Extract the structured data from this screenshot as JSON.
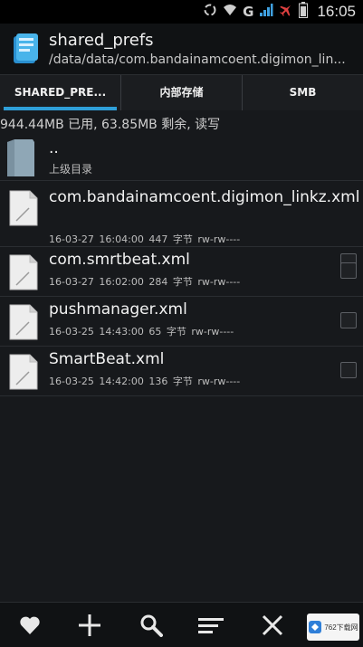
{
  "status_bar": {
    "time": "16:05",
    "network": "G",
    "icons": [
      "sync-icon",
      "wifi-icon",
      "signal-icon",
      "airplane-icon",
      "battery-icon"
    ]
  },
  "header": {
    "title": "shared_prefs",
    "path": "/data/data/com.bandainamcoent.digimon_lin..."
  },
  "tabs": [
    {
      "label": "SHARED_PRE...",
      "active": true
    },
    {
      "label": "内部存储",
      "active": false
    },
    {
      "label": "SMB",
      "active": false
    }
  ],
  "storage_info": "944.44MB 已用, 63.85MB 剩余, 读写",
  "parent_dir": {
    "name": "..",
    "label": "上级目录"
  },
  "files": [
    {
      "name": "com.bandainamcoent.digimon_linkz.xml",
      "date": "16-03-27 16:04:00",
      "size": "447 字节",
      "perms": "rw-rw----"
    },
    {
      "name": "com.smrtbeat.xml",
      "date": "16-03-27 16:02:00",
      "size": "284 字节",
      "perms": "rw-rw----"
    },
    {
      "name": "pushmanager.xml",
      "date": "16-03-25 14:43:00",
      "size": "65 字节",
      "perms": "rw-rw----"
    },
    {
      "name": "SmartBeat.xml",
      "date": "16-03-25 14:42:00",
      "size": "136 字节",
      "perms": "rw-rw----"
    }
  ],
  "toolbar": {
    "icons": [
      "heart-icon",
      "plus-icon",
      "search-icon",
      "sort-icon",
      "close-icon"
    ]
  },
  "colors": {
    "accent": "#2f9fd8",
    "background": "#17191c"
  }
}
